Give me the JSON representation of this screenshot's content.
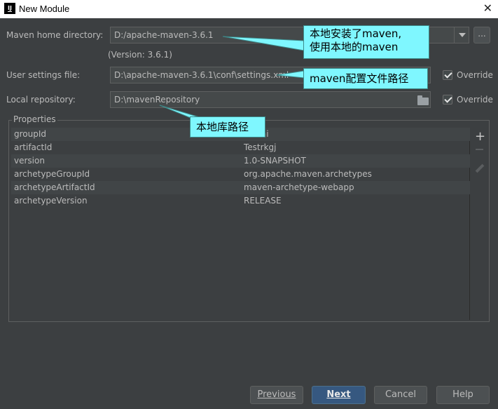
{
  "window": {
    "title": "New Module",
    "app_icon": "IJ",
    "close_glyph": "✕"
  },
  "maven_home": {
    "label": "Maven home directory:",
    "value": "D:/apache-maven-3.6.1",
    "version_note": "(Version: 3.6.1)",
    "browse_label": "..."
  },
  "user_settings": {
    "label": "User settings file:",
    "value": "D:\\apache-maven-3.6.1\\conf\\settings.xml",
    "override_label": "Override",
    "override_checked": true
  },
  "local_repo": {
    "label": "Local repository:",
    "value": "D:\\mavenRepository",
    "override_label": "Override",
    "override_checked": true
  },
  "properties": {
    "title": "Properties",
    "rows": [
      {
        "key": "groupId",
        "value": "haizhi"
      },
      {
        "key": "artifactId",
        "value": "Testrkgj"
      },
      {
        "key": "version",
        "value": "1.0-SNAPSHOT"
      },
      {
        "key": "archetypeGroupId",
        "value": "org.apache.maven.archetypes"
      },
      {
        "key": "archetypeArtifactId",
        "value": "maven-archetype-webapp"
      },
      {
        "key": "archetypeVersion",
        "value": "RELEASE"
      }
    ],
    "add_glyph": "+"
  },
  "callouts": {
    "maven_local": {
      "line1": "本地安装了maven,",
      "line2": "使用本地的maven"
    },
    "settings_path": {
      "text": "maven配置文件路径"
    },
    "repo_path": {
      "text": "本地库路径"
    }
  },
  "buttons": {
    "previous": "Previous",
    "next": "Next",
    "cancel": "Cancel",
    "help": "Help"
  },
  "colors": {
    "background": "#3c3f41",
    "callout": "#7ff7ff",
    "primary_button": "#365880"
  }
}
